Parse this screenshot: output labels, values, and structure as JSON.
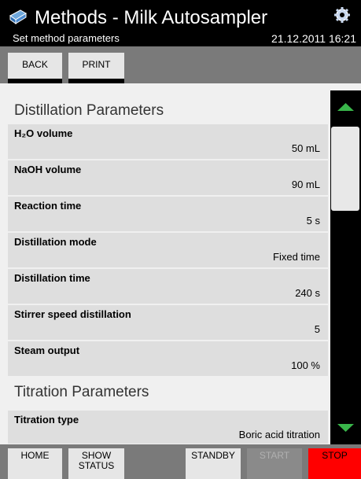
{
  "header": {
    "title": "Methods - Milk Autosampler",
    "subtitle": "Set method parameters",
    "datetime": "21.12.2011 16:21",
    "logo_icon": "app-logo-icon",
    "settings_icon": "gear-icon"
  },
  "toolbar": {
    "back_label": "BACK",
    "print_label": "PRINT"
  },
  "sections": [
    {
      "title": "Distillation Parameters",
      "rows": [
        {
          "label": "H₂O volume",
          "value": "50 mL"
        },
        {
          "label": "NaOH volume",
          "value": "90 mL"
        },
        {
          "label": "Reaction time",
          "value": "5 s"
        },
        {
          "label": "Distillation mode",
          "value": "Fixed time"
        },
        {
          "label": "Distillation time",
          "value": "240 s"
        },
        {
          "label": "Stirrer speed distillation",
          "value": "5"
        },
        {
          "label": "Steam output",
          "value": "100 %"
        }
      ]
    },
    {
      "title": "Titration Parameters",
      "rows": [
        {
          "label": "Titration type",
          "value": "Boric acid titration"
        }
      ]
    }
  ],
  "footer": {
    "home_label": "HOME",
    "show_label_1": "SHOW",
    "show_label_2": "STATUS",
    "standby_label": "STANDBY",
    "start_label": "START",
    "stop_label": "STOP"
  },
  "colors": {
    "accent_green": "#39b54a",
    "stop_red": "#ff0000"
  }
}
